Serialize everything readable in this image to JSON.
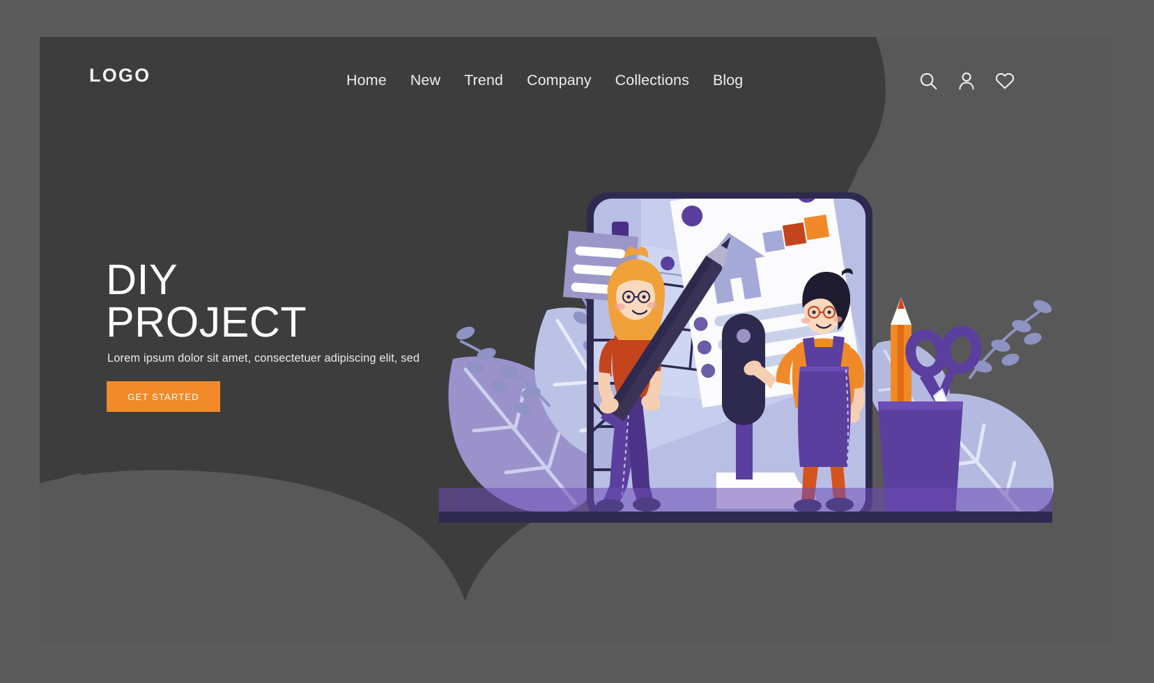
{
  "brand": {
    "logo": "LOGO"
  },
  "nav": {
    "items": [
      {
        "label": "Home"
      },
      {
        "label": "New"
      },
      {
        "label": "Trend"
      },
      {
        "label": "Company"
      },
      {
        "label": "Collections"
      },
      {
        "label": "Blog"
      }
    ]
  },
  "header_icons": [
    {
      "name": "search-icon"
    },
    {
      "name": "user-icon"
    },
    {
      "name": "heart-icon"
    }
  ],
  "hero": {
    "title": "DIY\nPROJECT",
    "subtitle": "Lorem ipsum dolor sit amet, consectetuer adipiscing elit, sed",
    "cta_label": "GET STARTED"
  },
  "illustration": {
    "alt": "Two people planning a DIY home project on a large tablet with blueprints, sticky note, pencil, scissors and tiles",
    "elements": [
      "tablet-screen",
      "sticky-note",
      "blueprint-paper",
      "checklist-paper",
      "woman-with-pencil",
      "man-with-paint-roller",
      "pencil-cup",
      "scissors",
      "orange-pencil",
      "tile-stack",
      "leaves"
    ]
  },
  "colors": {
    "page_background": "#5b5b5b",
    "frame_background": "#3d3d3d",
    "blob_light": "#585858",
    "accent_orange": "#F18A29",
    "text_primary": "#ffffff",
    "text_secondary": "#e9e9e9",
    "illustration_dark_purple": "#2e2a4f",
    "illustration_purple": "#5b3f9e",
    "illustration_lavender": "#b9bde4",
    "illustration_light": "#ced3ef",
    "illustration_orange": "#f08a28",
    "illustration_rust": "#d4541f"
  }
}
